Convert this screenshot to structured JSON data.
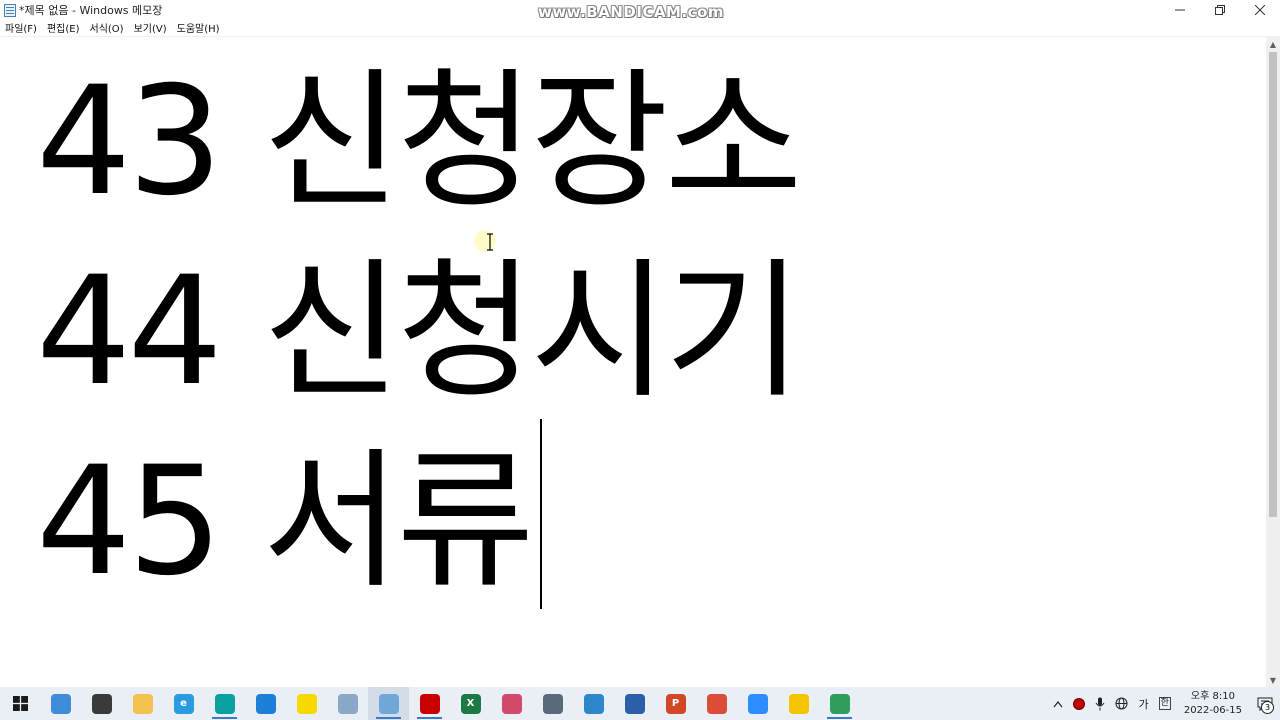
{
  "window": {
    "title": "*제목 없음 - Windows 메모장",
    "watermark": "www.BANDICAM.com"
  },
  "menu": {
    "items": [
      {
        "label": "파일(F)"
      },
      {
        "label": "편집(E)"
      },
      {
        "label": "서식(O)"
      },
      {
        "label": "보기(V)"
      },
      {
        "label": "도움말(H)"
      }
    ]
  },
  "editor": {
    "lines": [
      "43 신청장소",
      "44 신청시기",
      "45 서류"
    ]
  },
  "taskbar": {
    "apps": [
      {
        "icon": "file-explorer-icon",
        "color": "#3d8bd9",
        "glyph": "",
        "active": false,
        "running": false
      },
      {
        "icon": "davinci-resolve-icon",
        "color": "#3a3a3a",
        "glyph": "",
        "active": false,
        "running": false
      },
      {
        "icon": "folder-icon",
        "color": "#f2c14e",
        "glyph": "",
        "active": false,
        "running": false
      },
      {
        "icon": "internet-explorer-icon",
        "color": "#2a9be0",
        "glyph": "e",
        "active": false,
        "running": false
      },
      {
        "icon": "whale-browser-icon",
        "color": "#0aa0a0",
        "glyph": "",
        "active": false,
        "running": true
      },
      {
        "icon": "edge-icon",
        "color": "#1e7fd6",
        "glyph": "",
        "active": false,
        "running": false
      },
      {
        "icon": "kakaotalk-icon",
        "color": "#f7d900",
        "glyph": "",
        "active": false,
        "running": false
      },
      {
        "icon": "paint-brush-icon",
        "color": "#8aa8c8",
        "glyph": "",
        "active": false,
        "running": false
      },
      {
        "icon": "notepad-icon",
        "color": "#6fa8d8",
        "glyph": "",
        "active": true,
        "running": true
      },
      {
        "icon": "bandicam-record-icon",
        "color": "#c80000",
        "glyph": "",
        "active": false,
        "running": true
      },
      {
        "icon": "excel-icon",
        "color": "#1d7a45",
        "glyph": "X",
        "active": false,
        "running": false
      },
      {
        "icon": "snipping-tool-icon",
        "color": "#d14a6a",
        "glyph": "",
        "active": false,
        "running": false
      },
      {
        "icon": "calculator-icon",
        "color": "#5a6a7a",
        "glyph": "",
        "active": false,
        "running": false
      },
      {
        "icon": "hwp-icon",
        "color": "#2d86c9",
        "glyph": "",
        "active": false,
        "running": false
      },
      {
        "icon": "network-drive-icon",
        "color": "#2b5fa8",
        "glyph": "",
        "active": false,
        "running": false
      },
      {
        "icon": "powerpoint-icon",
        "color": "#d24726",
        "glyph": "P",
        "active": false,
        "running": false
      },
      {
        "icon": "chrome-icon",
        "color": "#dd4b39",
        "glyph": "",
        "active": false,
        "running": false
      },
      {
        "icon": "zoom-icon",
        "color": "#2d8cff",
        "glyph": "",
        "active": false,
        "running": false
      },
      {
        "icon": "video-player-icon",
        "color": "#f5c400",
        "glyph": "",
        "active": false,
        "running": false
      },
      {
        "icon": "chrome-profile-icon",
        "color": "#2f9e5a",
        "glyph": "",
        "active": false,
        "running": true
      }
    ]
  },
  "tray": {
    "ime_mode": "가",
    "ime_lang": "한",
    "time": "오후 8:10",
    "date": "2022-06-15",
    "notification_count": "3"
  }
}
